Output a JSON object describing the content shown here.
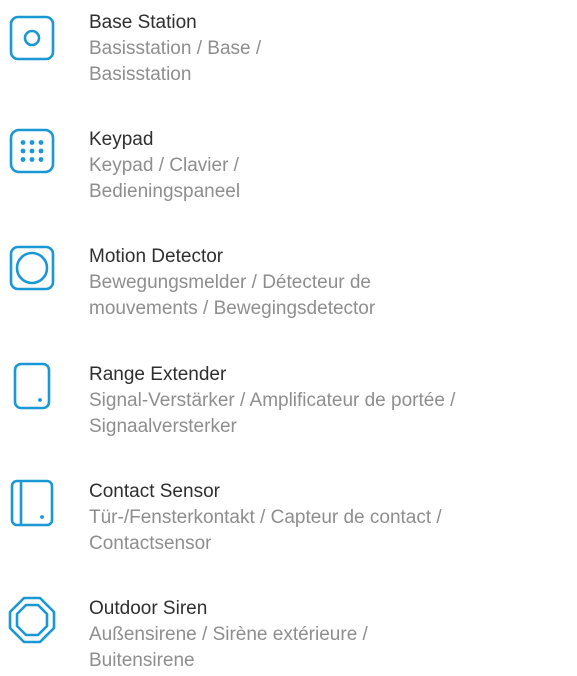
{
  "accent_color": "#1998d5",
  "items": [
    {
      "icon": "base-station-icon",
      "title": "Base Station",
      "sub_1": "Basisstation / Base /",
      "sub_2": "Basisstation"
    },
    {
      "icon": "keypad-icon",
      "title": "Keypad",
      "sub_1": "Keypad / Clavier /",
      "sub_2": "Bedieningspaneel"
    },
    {
      "icon": "motion-detector-icon",
      "title": "Motion Detector",
      "sub_1": "Bewegungsmelder / Détecteur de",
      "sub_2": "mouvements / Bewegingsdetector"
    },
    {
      "icon": "range-extender-icon",
      "title": "Range Extender",
      "sub_1": "Signal-Verstärker / Amplificateur de portée /",
      "sub_2": "Signaalversterker"
    },
    {
      "icon": "contact-sensor-icon",
      "title": "Contact Sensor",
      "sub_1": "Tür-/Fensterkontakt / Capteur de contact /",
      "sub_2": "Contactsensor"
    },
    {
      "icon": "outdoor-siren-icon",
      "title": "Outdoor Siren",
      "sub_1": "Außensirene / Sirène extérieure /",
      "sub_2": "Buitensirene"
    }
  ]
}
